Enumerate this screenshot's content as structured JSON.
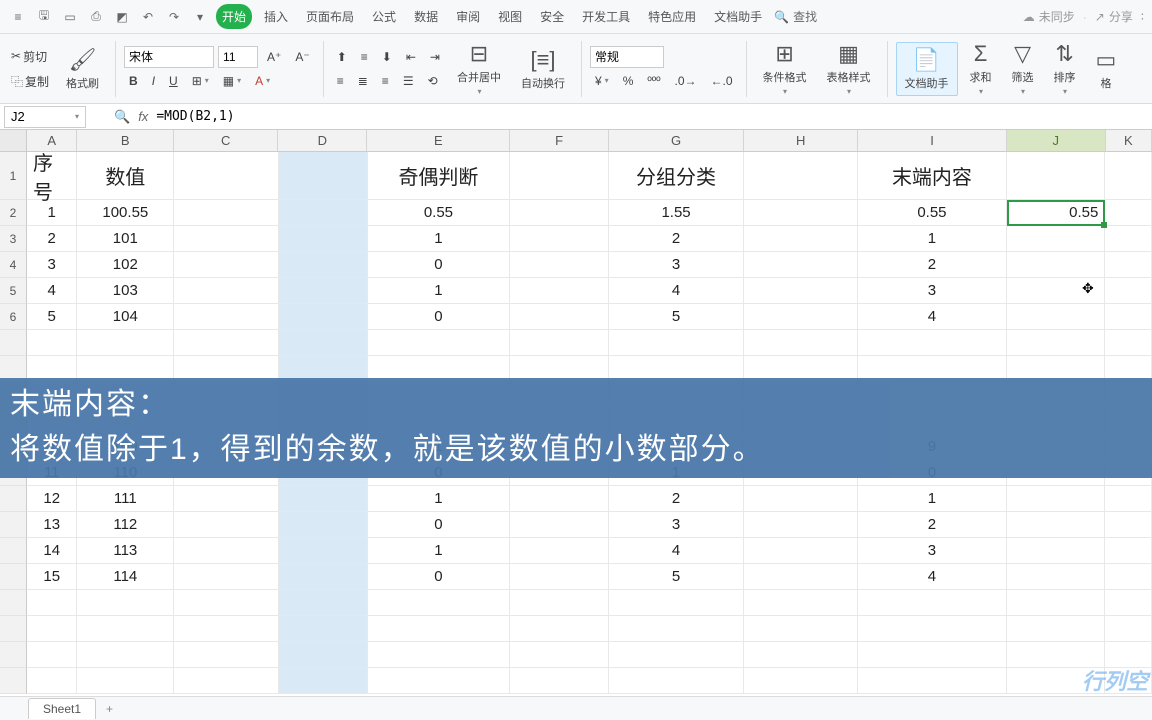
{
  "titlebar": {
    "active_tab": "开始",
    "menus": [
      "插入",
      "页面布局",
      "公式",
      "数据",
      "审阅",
      "视图",
      "安全",
      "开发工具",
      "特色应用",
      "文档助手"
    ],
    "search_label": "查找",
    "sync_label": "未同步",
    "share_label": "分享"
  },
  "ribbon": {
    "cut": "剪切",
    "copy": "复制",
    "format_painter": "格式刷",
    "font_name": "宋体",
    "font_size": "11",
    "merge_center": "合并居中",
    "wrap_text": "自动换行",
    "number_format": "常规",
    "cond_format": "条件格式",
    "table_style": "表格样式",
    "doc_helper": "文档助手",
    "sum": "求和",
    "filter": "筛选",
    "sort": "排序",
    "format": "格"
  },
  "formula_bar": {
    "name_box": "J2",
    "fx": "fx",
    "formula": "=MOD(B2,1)"
  },
  "columns": [
    "A",
    "B",
    "C",
    "D",
    "E",
    "F",
    "G",
    "H",
    "I",
    "J",
    "K"
  ],
  "header_row": {
    "A": "序号",
    "B": "数值",
    "E": "奇偶判断",
    "G": "分组分类",
    "I": "末端内容"
  },
  "data_rows": [
    {
      "r": "2",
      "A": "1",
      "B": "100.55",
      "E": "0.55",
      "G": "1.55",
      "I": "0.55",
      "J": "0.55"
    },
    {
      "r": "3",
      "A": "2",
      "B": "101",
      "E": "1",
      "G": "2",
      "I": "1"
    },
    {
      "r": "4",
      "A": "3",
      "B": "102",
      "E": "0",
      "G": "3",
      "I": "2"
    },
    {
      "r": "5",
      "A": "4",
      "B": "103",
      "E": "1",
      "G": "4",
      "I": "3"
    },
    {
      "r": "6",
      "A": "5",
      "B": "104",
      "E": "0",
      "G": "5",
      "I": "4"
    }
  ],
  "data_rows2": [
    {
      "r": "",
      "A": "10",
      "B": "109",
      "E": "1",
      "G": "5",
      "I": "9"
    },
    {
      "r": "",
      "A": "11",
      "B": "110",
      "E": "0",
      "G": "1",
      "I": "0"
    },
    {
      "r": "",
      "A": "12",
      "B": "111",
      "E": "1",
      "G": "2",
      "I": "1"
    },
    {
      "r": "",
      "A": "13",
      "B": "112",
      "E": "0",
      "G": "3",
      "I": "2"
    },
    {
      "r": "",
      "A": "14",
      "B": "113",
      "E": "1",
      "G": "4",
      "I": "3"
    },
    {
      "r": "",
      "A": "15",
      "B": "114",
      "E": "0",
      "G": "5",
      "I": "4"
    }
  ],
  "banner": {
    "line1": "末端内容：",
    "line2": "将数值除于1，得到的余数，就是该数值的小数部分。"
  },
  "sheet_tab": "Sheet1",
  "watermark": "行列空"
}
